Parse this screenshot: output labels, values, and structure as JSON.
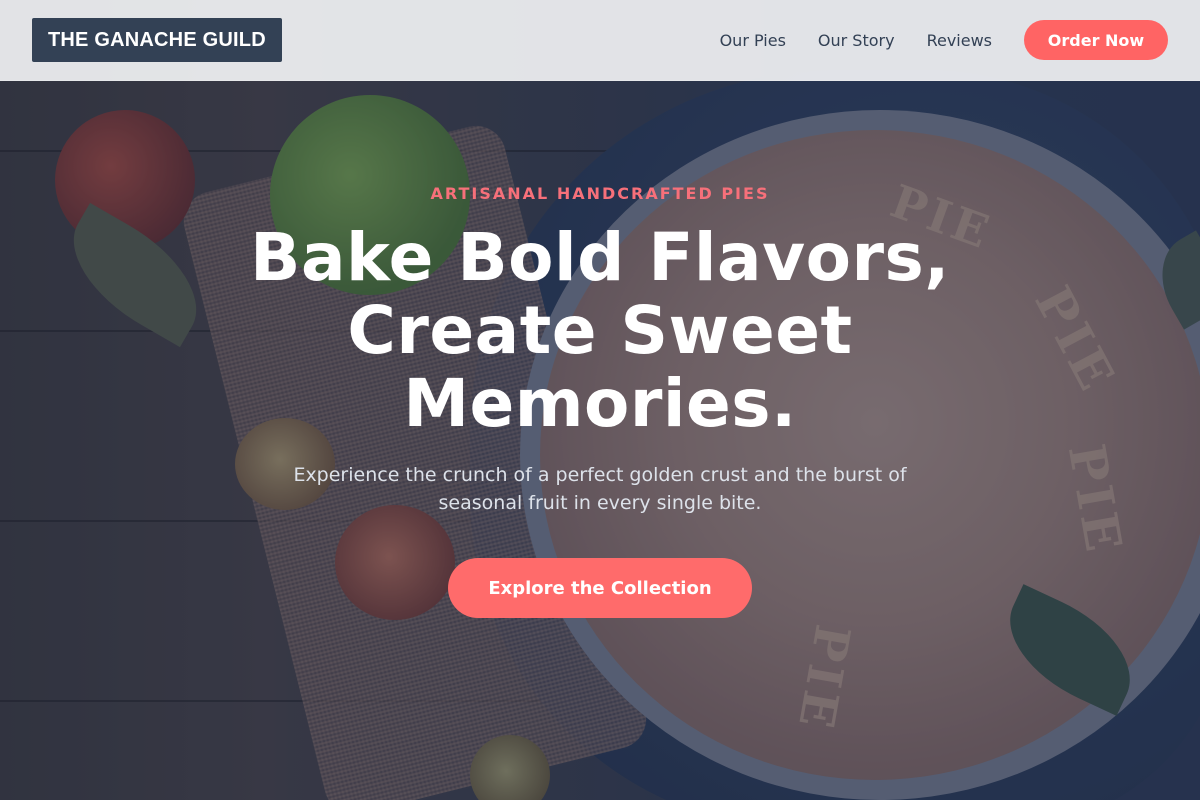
{
  "header": {
    "logo": "THE GANACHE GUILD",
    "nav": [
      {
        "label": "Our Pies"
      },
      {
        "label": "Our Story"
      },
      {
        "label": "Reviews"
      }
    ],
    "cta_label": "Order Now"
  },
  "hero": {
    "eyebrow": "ARTISANAL HANDCRAFTED PIES",
    "headline": "Bake Bold Flavors, Create Sweet Memories.",
    "subtext": "Experience the crunch of a perfect golden crust and the burst of seasonal fruit in every single bite.",
    "cta_label": "Explore the Collection",
    "background_letters": [
      "PIE",
      "PIE",
      "PIE",
      "PIE"
    ]
  },
  "colors": {
    "accent": "#ff6b6b",
    "eyebrow": "#f7707a",
    "logo_bg": "#334155",
    "nav_text": "#334155",
    "overlay": "#202a42"
  }
}
